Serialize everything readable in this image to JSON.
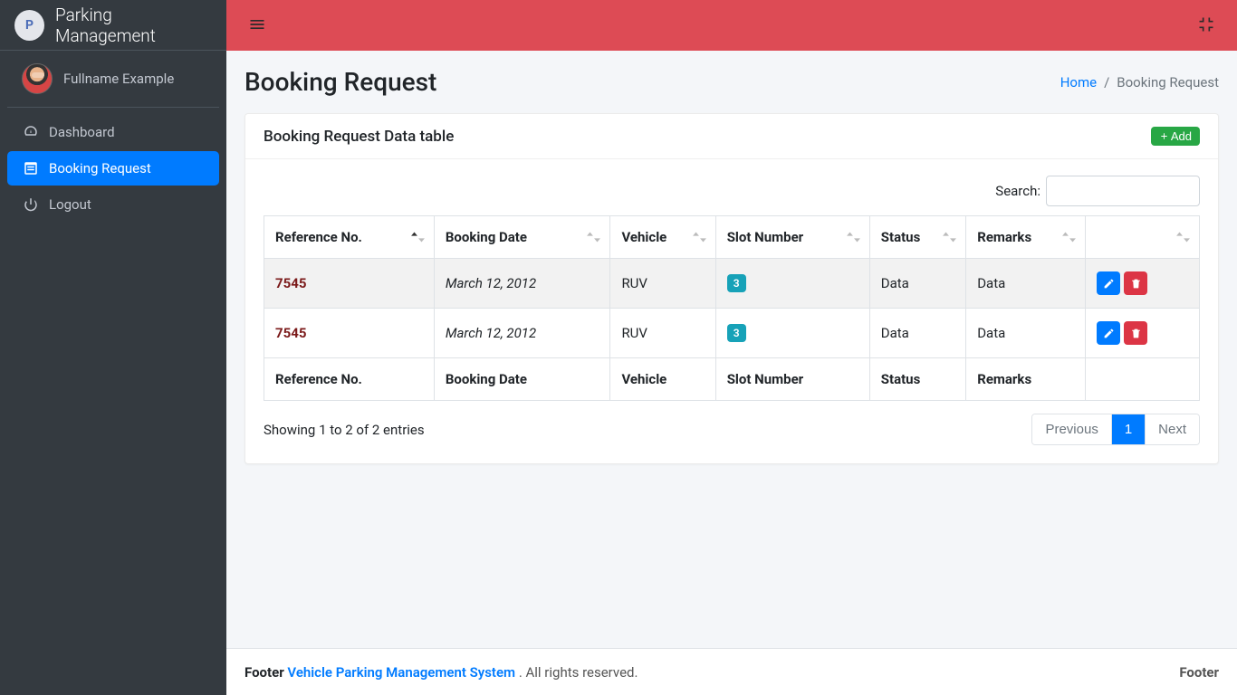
{
  "brand": {
    "logo_text": "P",
    "title": "Parking Management"
  },
  "user": {
    "name": "Fullname Example"
  },
  "sidebar": {
    "items": [
      {
        "label": "Dashboard",
        "icon": "dashboard-icon",
        "active": false
      },
      {
        "label": "Booking Request",
        "icon": "booking-icon",
        "active": true
      },
      {
        "label": "Logout",
        "icon": "power-icon",
        "active": false
      }
    ]
  },
  "page": {
    "title": "Booking Request",
    "breadcrumb_home": "Home",
    "breadcrumb_current": "Booking Request"
  },
  "card": {
    "title": "Booking Request Data table",
    "add_label": "Add"
  },
  "table": {
    "search_label": "Search:",
    "search_value": "",
    "columns": [
      "Reference No.",
      "Booking Date",
      "Vehicle",
      "Slot Number",
      "Status",
      "Remarks",
      ""
    ],
    "rows": [
      {
        "ref": "7545",
        "date": "March 12, 2012",
        "vehicle": "RUV",
        "slot": "3",
        "status": "Data",
        "remarks": "Data"
      },
      {
        "ref": "7545",
        "date": "March 12, 2012",
        "vehicle": "RUV",
        "slot": "3",
        "status": "Data",
        "remarks": "Data"
      }
    ],
    "info_text": "Showing 1 to 2 of 2 entries",
    "paginate": {
      "prev": "Previous",
      "pages": [
        "1"
      ],
      "next": "Next",
      "active_index": 0
    }
  },
  "footer": {
    "left_label": "Footer",
    "system_name": "Vehicle Parking Management System",
    "dot": " . ",
    "rights": "All rights reserved.",
    "right_label": "Footer"
  }
}
